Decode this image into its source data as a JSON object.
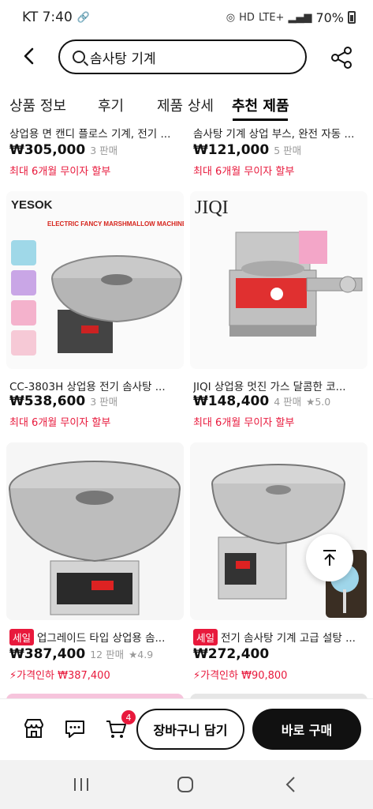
{
  "status_bar": {
    "carrier_time": "KT 7:40",
    "network": "LTE+",
    "battery": "70%"
  },
  "header": {
    "search_value": "솜사탕 기계"
  },
  "tabs": [
    {
      "label": "상품 정보"
    },
    {
      "label": "후기"
    },
    {
      "label": "제품 상세"
    },
    {
      "label": "추천 제품"
    }
  ],
  "products": [
    {
      "title": "상업용 면 캔디 플로스 기계, 전기 ...",
      "price": "₩305,000",
      "sold": "3 판매",
      "promo": "최대 6개월 무이자 할부"
    },
    {
      "title": "솜사탕 기계 상업 부스, 완전 자동 ...",
      "price": "₩121,000",
      "sold": "5 판매",
      "promo": "최대 6개월 무이자 할부"
    },
    {
      "brand": "YESOK",
      "banner": "ELECTRIC FANCY MARSHMALLOW MACHINE",
      "title": "CC-3803H 상업용 전기 솜사탕 ...",
      "price": "₩538,600",
      "sold": "3 판매",
      "promo": "최대 6개월 무이자 할부"
    },
    {
      "brand": "JIQI",
      "title": "JIQI 상업용 멋진 가스 달콤한 코...",
      "price": "₩148,400",
      "sold": "4 판매",
      "rating": "5.0",
      "promo": "최대 6개월 무이자 할부"
    },
    {
      "badge": "세일",
      "title": "업그레이드 타입 상업용 솜...",
      "price": "₩387,400",
      "sold": "12 판매",
      "rating": "4.9",
      "promo": "가격인하 ₩387,400"
    },
    {
      "badge": "세일",
      "title": "전기 솜사탕 기계 고급 설탕 ...",
      "price": "₩272,400",
      "promo": "가격인하 ₩90,800"
    }
  ],
  "bottom_bar": {
    "cart_count": "4",
    "add_to_cart": "장바구니 담기",
    "buy_now": "바로 구매"
  },
  "colors": {
    "accent_red": "#e8193c",
    "primary_black": "#111111"
  },
  "icons": [
    "back-icon",
    "search-icon",
    "share-icon",
    "store-icon",
    "chat-icon",
    "cart-icon",
    "scroll-top-icon",
    "recent-apps-icon",
    "home-icon",
    "nav-back-icon",
    "star-icon",
    "lightning-icon"
  ]
}
